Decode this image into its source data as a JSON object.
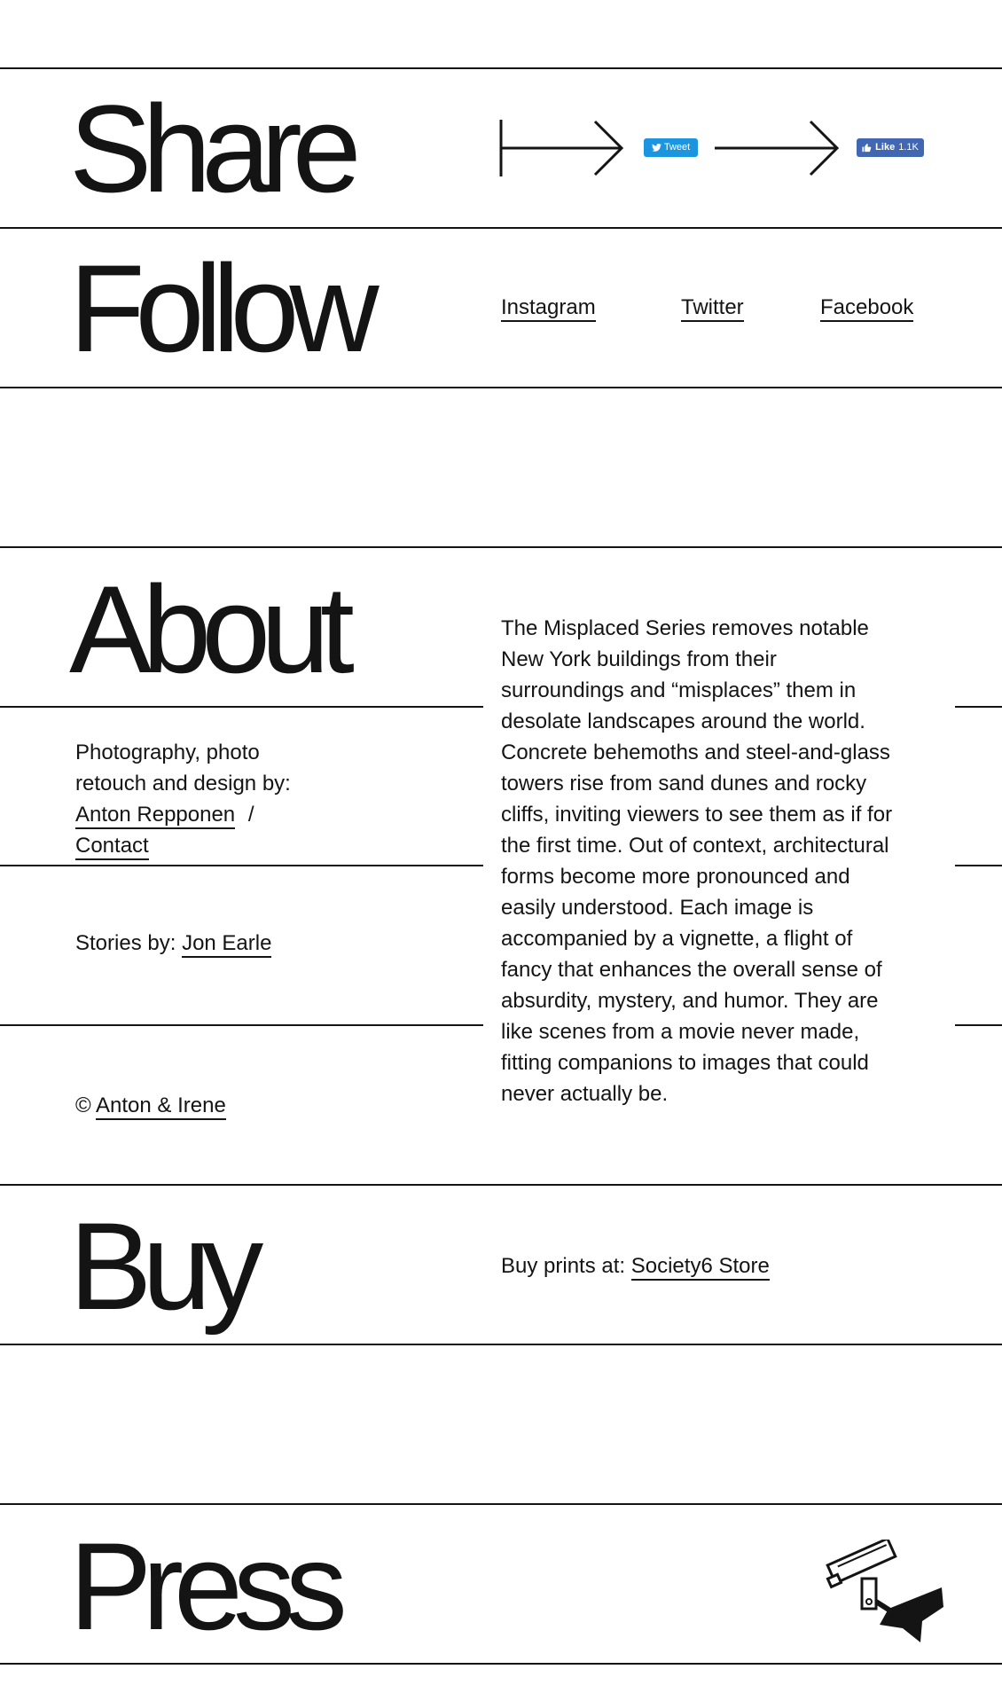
{
  "share": {
    "heading": "Share",
    "tweet_label": "Tweet",
    "like_label": "Like",
    "like_count": "1.1K",
    "colors": {
      "tweet": "#1b95e0",
      "like": "#4267b2"
    }
  },
  "follow": {
    "heading": "Follow",
    "links": [
      "Instagram",
      "Twitter",
      "Facebook"
    ]
  },
  "about": {
    "heading": "About",
    "credits_prefix": "Photography, photo retouch and design by:",
    "author_link": "Anton Repponen",
    "separator": "/",
    "contact_link": "Contact",
    "stories_prefix": "Stories by:",
    "stories_link": "Jon Earle",
    "copyright_symbol": "©",
    "copyright_link": "Anton & Irene",
    "description": "The Misplaced Series removes notable New York buildings from their surroundings and “misplaces” them in desolate landscapes around the world. Concrete behemoths and steel-and-glass towers rise from sand dunes and rocky cliffs, inviting viewers to see them as if for the first time. Out of context, architectural forms become more pronounced and easily understood. Each image is accompanied by a vignette, a flight of fancy that enhances the overall sense of absurdity, mystery, and humor. They are like scenes from a movie never made, fitting companions to images that could never actually be."
  },
  "buy": {
    "heading": "Buy",
    "prefix": "Buy prints at:",
    "store_link": "Society6 Store"
  },
  "press": {
    "heading": "Press",
    "logo_icon": "security-camera-icon"
  }
}
